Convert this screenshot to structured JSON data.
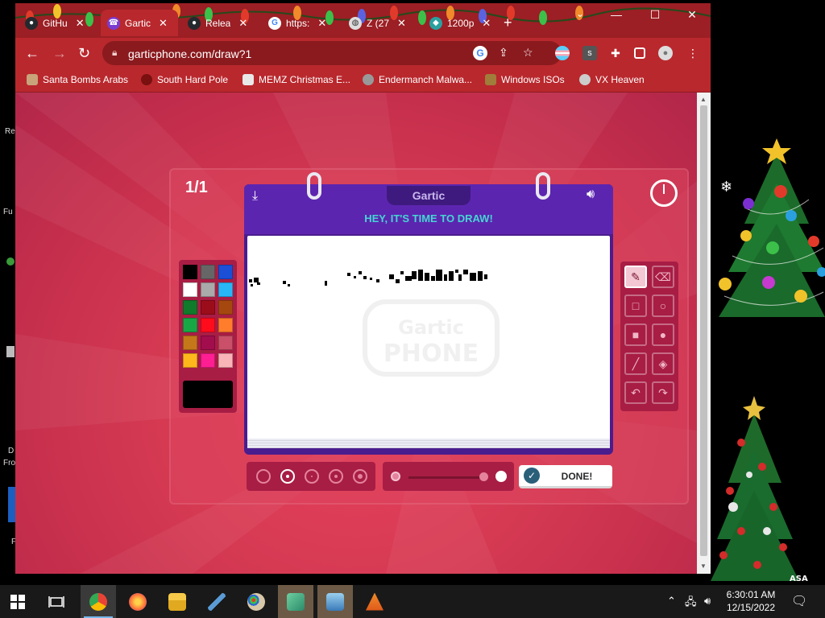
{
  "browser": {
    "tabs": [
      {
        "label": "GitHu",
        "favicon": "github-icon"
      },
      {
        "label": "Gartic",
        "favicon": "phone-icon"
      },
      {
        "label": "Relea",
        "favicon": "github-icon"
      },
      {
        "label": "https:",
        "favicon": "google-icon"
      },
      {
        "label": "Z (27",
        "favicon": "globe-icon"
      },
      {
        "label": "1200p",
        "favicon": "app-icon"
      }
    ],
    "url": "garticphone.com/draw?1",
    "bookmarks": [
      {
        "label": "Santa Bombs Arabs"
      },
      {
        "label": "South Hard Pole"
      },
      {
        "label": "MEMZ Christmas E..."
      },
      {
        "label": "Endermanch Malwa..."
      },
      {
        "label": "Windows ISOs"
      },
      {
        "label": "VX Heaven"
      }
    ]
  },
  "game": {
    "round": "1/1",
    "brand": "Gartic",
    "headline": "HEY, IT'S TIME TO DRAW!",
    "watermark_line1": "Gartic",
    "watermark_line2": "PHONE",
    "done_label": "DONE!",
    "palette": [
      "#000000",
      "#666666",
      "#1a4fd6",
      "#ffffff",
      "#aaaaaa",
      "#29b6f6",
      "#0f7b2b",
      "#9b0d1a",
      "#a5480f",
      "#17a845",
      "#ff0c1c",
      "#ff7d2b",
      "#c4781a",
      "#a20d4d",
      "#c95068",
      "#ffb81c",
      "#ff1f93",
      "#f9b4b8"
    ],
    "current_color": "#000000",
    "tools": [
      "pencil-tool",
      "eraser-tool",
      "rectangle-outline-tool",
      "ellipse-outline-tool",
      "rectangle-fill-tool",
      "ellipse-fill-tool",
      "line-tool",
      "fill-bucket-tool",
      "undo-tool",
      "redo-tool"
    ],
    "selected_tool": "pencil-tool",
    "brush_sizes": [
      "size-1",
      "size-2",
      "size-3",
      "size-4",
      "size-5"
    ],
    "selected_size": "size-2"
  },
  "desktop": {
    "left_labels": [
      "Re",
      "Fu",
      "D",
      "Fro",
      "F"
    ]
  },
  "taskbar": {
    "apps": [
      "chrome-icon",
      "firefox-icon",
      "file-explorer-icon",
      "pen-icon",
      "paint-icon",
      "app-icon",
      "remote-desktop-icon",
      "vlc-icon"
    ],
    "time": "6:30:01 AM",
    "date": "12/15/2022"
  }
}
